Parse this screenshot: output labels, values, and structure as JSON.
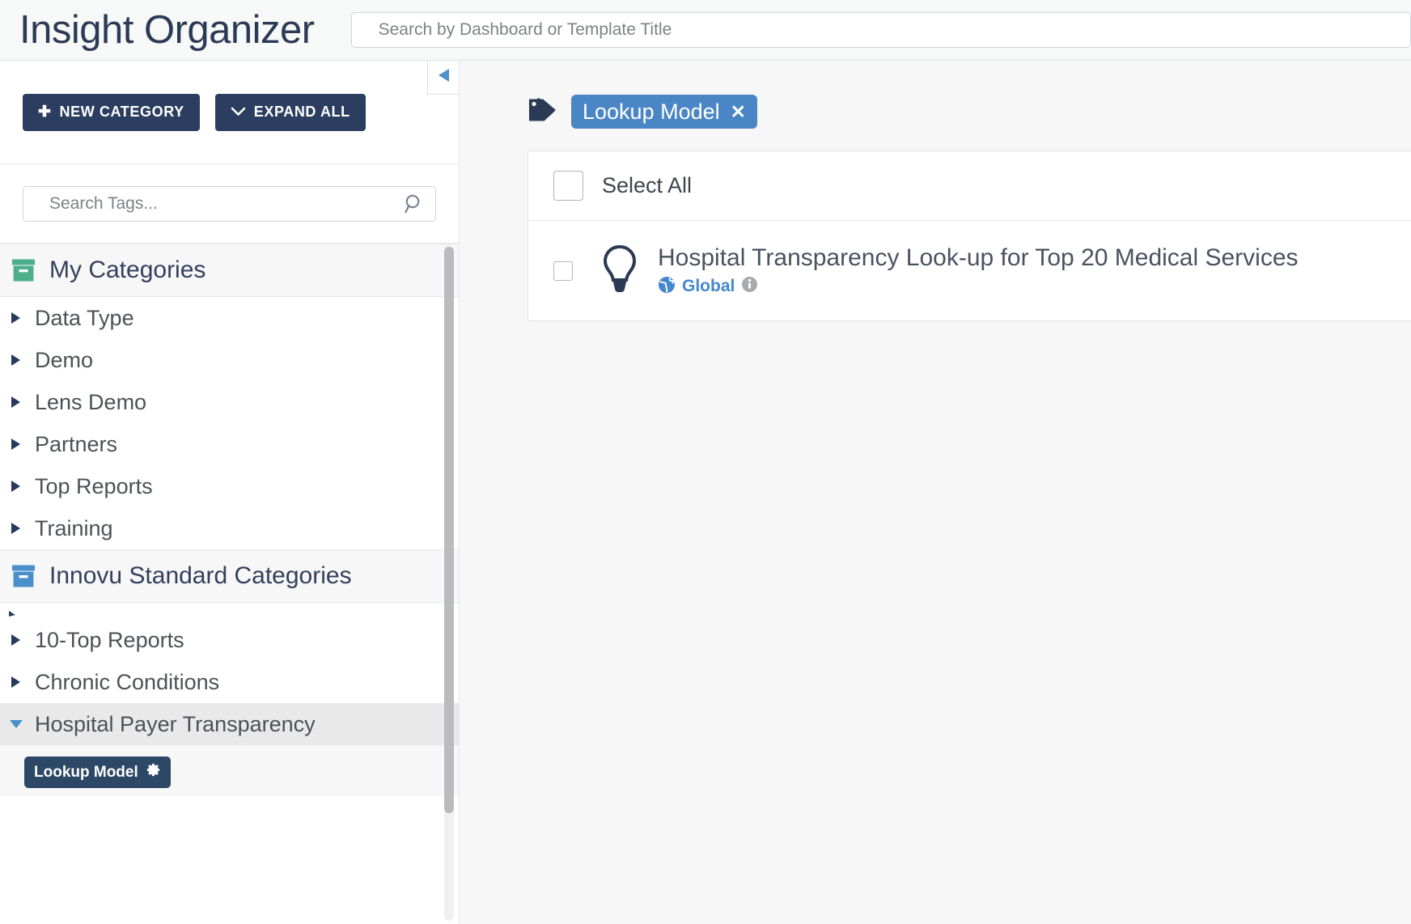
{
  "header": {
    "title": "Insight Organizer",
    "search": {
      "placeholder": "Search by Dashboard or Template Title",
      "value": ""
    }
  },
  "sidebar": {
    "buttons": {
      "new_category": "NEW CATEGORY",
      "new_category_icon": "plus-icon",
      "expand_all": "EXPAND ALL",
      "expand_all_icon": "chevron-down-icon"
    },
    "tag_search": {
      "placeholder": "Search Tags...",
      "value": "",
      "icon": "search-icon"
    },
    "sections": [
      {
        "label": "My Categories",
        "icon": "archive-box-icon",
        "icon_color": "#4cae8b",
        "items": [
          {
            "label": "Data Type",
            "expanded": false
          },
          {
            "label": "Demo",
            "expanded": false
          },
          {
            "label": "Lens Demo",
            "expanded": false
          },
          {
            "label": "Partners",
            "expanded": false
          },
          {
            "label": "Top Reports",
            "expanded": false
          },
          {
            "label": "Training",
            "expanded": false
          }
        ]
      },
      {
        "label": "Innovu Standard Categories",
        "icon": "archive-box-icon",
        "icon_color": "#4a8fcc",
        "items": [
          {
            "label": "10-Top Reports",
            "expanded": false
          },
          {
            "label": "Chronic Conditions",
            "expanded": false
          },
          {
            "label": "Hospital Payer Transparency",
            "expanded": true
          }
        ]
      }
    ],
    "child_tag": {
      "label": "Lookup Model",
      "icon": "gear-icon"
    },
    "collapse_toggle_icon": "triangle-left-icon"
  },
  "main": {
    "filter": {
      "tag_icon": "tag-icon",
      "chip_label": "Lookup Model",
      "chip_remove_icon": "close-icon"
    },
    "results": {
      "select_all_label": "Select All",
      "select_all_checked": false,
      "rows": [
        {
          "icon": "lightbulb-icon",
          "title": "Hospital Transparency Look-up for Top 20 Medical Services",
          "scope_icon": "globe-icon",
          "scope_label": "Global",
          "info_icon": "info-icon",
          "checked": false
        }
      ]
    }
  },
  "colors": {
    "brand_navy": "#2b3e60",
    "accent_blue": "#4a86c5",
    "link_blue": "#4387cf",
    "tag_navy": "#2d4866",
    "green_box": "#4cae8b",
    "blue_box": "#4a8fcc"
  }
}
